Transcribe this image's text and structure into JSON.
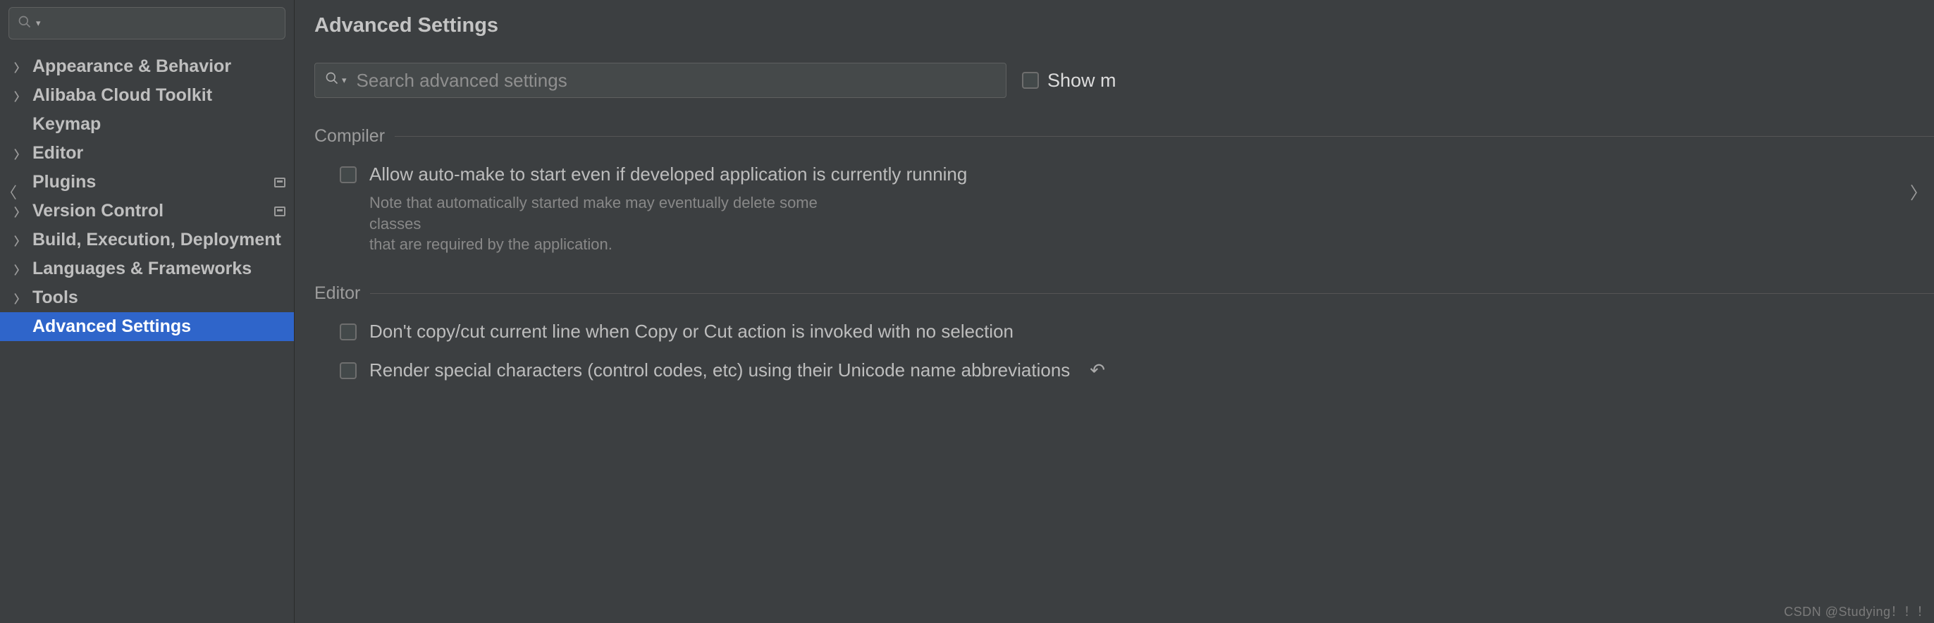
{
  "sidebar": {
    "items": [
      {
        "label": "Appearance & Behavior",
        "expandable": true,
        "marker": false
      },
      {
        "label": "Alibaba Cloud Toolkit",
        "expandable": true,
        "marker": false
      },
      {
        "label": "Keymap",
        "expandable": false,
        "marker": false
      },
      {
        "label": "Editor",
        "expandable": true,
        "marker": false
      },
      {
        "label": "Plugins",
        "expandable": false,
        "marker": true
      },
      {
        "label": "Version Control",
        "expandable": true,
        "marker": true
      },
      {
        "label": "Build, Execution, Deployment",
        "expandable": true,
        "marker": false
      },
      {
        "label": "Languages & Frameworks",
        "expandable": true,
        "marker": false
      },
      {
        "label": "Tools",
        "expandable": true,
        "marker": false
      },
      {
        "label": "Advanced Settings",
        "expandable": false,
        "marker": false,
        "selected": true
      }
    ]
  },
  "main": {
    "title": "Advanced Settings",
    "search_placeholder": "Search advanced settings",
    "show_modified_label": "Show m",
    "sections": {
      "compiler": {
        "title": "Compiler",
        "opt1_label": "Allow auto-make to start even if developed application is currently running",
        "opt1_note_line1": "Note that automatically started make may eventually delete some classes",
        "opt1_note_line2": "that are required by the application."
      },
      "editor": {
        "title": "Editor",
        "opt1_label": "Don't copy/cut current line when Copy or Cut action is invoked with no selection",
        "opt2_label": "Render special characters (control codes, etc) using their Unicode name abbreviations"
      }
    }
  },
  "watermark": "CSDN @Studying！！！"
}
